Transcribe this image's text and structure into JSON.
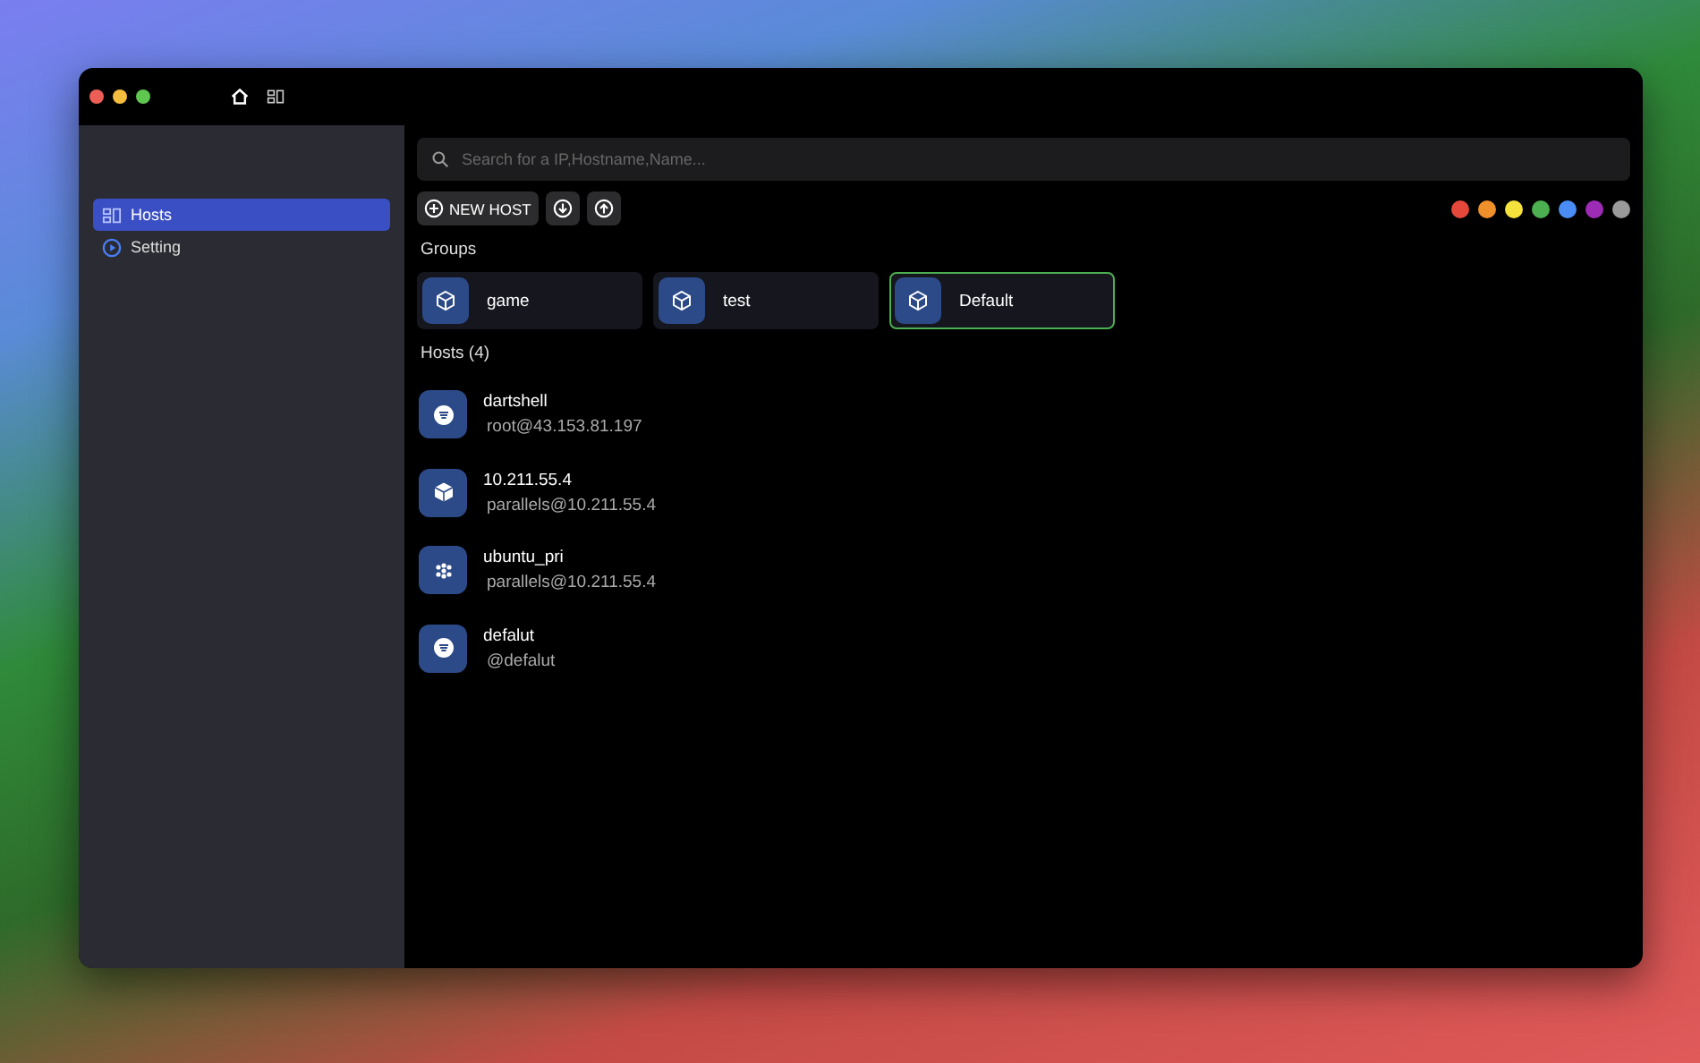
{
  "sidebar": {
    "items": [
      {
        "label": "Hosts",
        "kind": "hosts",
        "selected": true
      },
      {
        "label": "Setting",
        "kind": "play",
        "selected": false
      }
    ]
  },
  "search": {
    "placeholder": "Search for a IP,Hostname,Name..."
  },
  "toolbar": {
    "new_host": "NEW HOST"
  },
  "color_filters": [
    {
      "color": "#e5483b"
    },
    {
      "color": "#f0902a"
    },
    {
      "color": "#f5e23c"
    },
    {
      "color": "#4caf50"
    },
    {
      "color": "#4a8ef5"
    },
    {
      "color": "#9c2bb5"
    },
    {
      "color": "#9a9a9a"
    }
  ],
  "groups_heading": "Groups",
  "groups": [
    {
      "name": "game",
      "selected": false
    },
    {
      "name": "test",
      "selected": false
    },
    {
      "name": "Default",
      "selected": true
    }
  ],
  "hosts_heading": "Hosts (4)",
  "hosts": [
    {
      "name": "dartshell",
      "address": "root@43.153.81.197",
      "kind": "stack"
    },
    {
      "name": "10.211.55.4",
      "address": "parallels@10.211.55.4",
      "kind": "cube"
    },
    {
      "name": "ubuntu_pri",
      "address": "parallels@10.211.55.4",
      "kind": "dots"
    },
    {
      "name": "defalut",
      "address": "@defalut",
      "kind": "stack"
    }
  ]
}
